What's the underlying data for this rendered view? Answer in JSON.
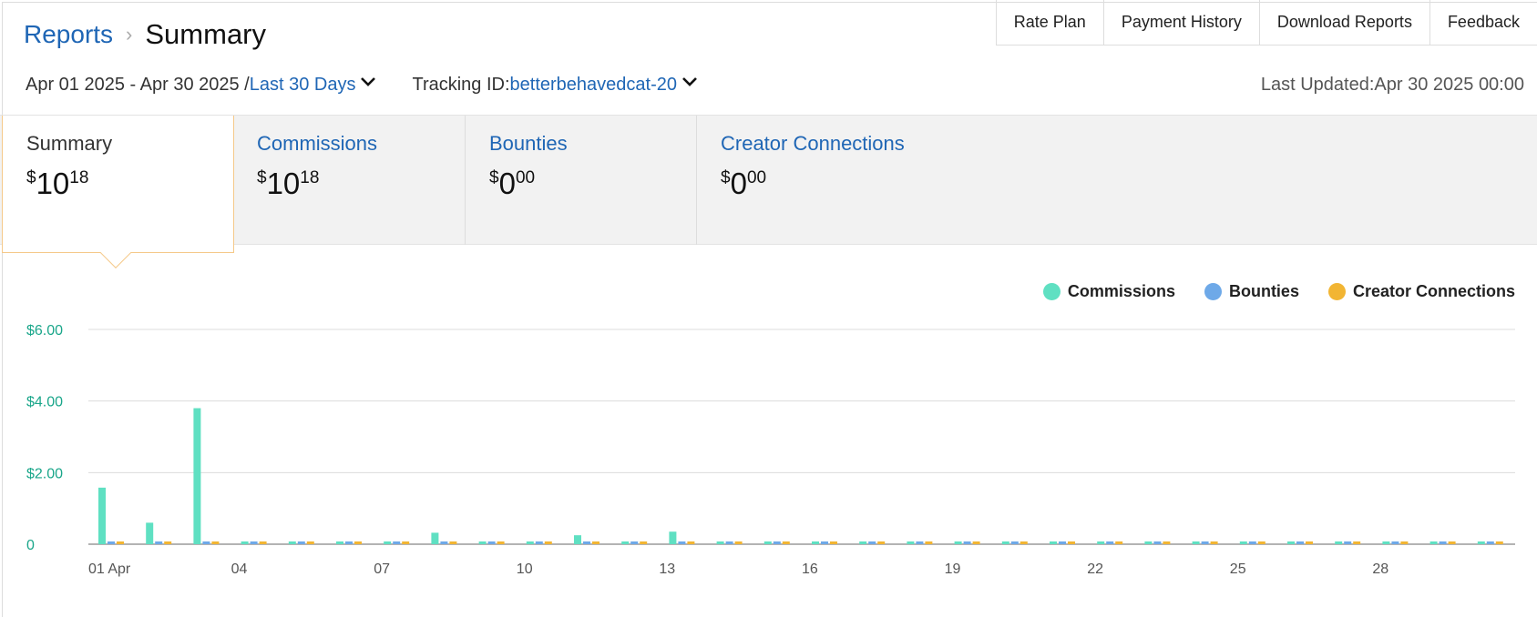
{
  "breadcrumb": {
    "parent": "Reports",
    "separator": "›",
    "current": "Summary"
  },
  "topnav": [
    "Rate Plan",
    "Payment History",
    "Download Reports",
    "Feedback"
  ],
  "filters": {
    "date_range": "Apr 01 2025 - Apr 30 2025 /",
    "range_preset": "Last 30 Days",
    "tracking_label": "Tracking ID:",
    "tracking_id": "betterbehavedcat-20",
    "last_updated": "Last Updated:Apr 30 2025 00:00"
  },
  "tiles": [
    {
      "label": "Summary",
      "currency": "$",
      "whole": "10",
      "cents": "18",
      "active": true
    },
    {
      "label": "Commissions",
      "currency": "$",
      "whole": "10",
      "cents": "18",
      "active": false
    },
    {
      "label": "Bounties",
      "currency": "$",
      "whole": "0",
      "cents": "00",
      "active": false
    },
    {
      "label": "Creator Connections",
      "currency": "$",
      "whole": "0",
      "cents": "00",
      "active": false
    }
  ],
  "legend": [
    {
      "name": "Commissions",
      "color": "#5fe0c2"
    },
    {
      "name": "Bounties",
      "color": "#6ea9e8"
    },
    {
      "name": "Creator Connections",
      "color": "#f2b533"
    }
  ],
  "chart_data": {
    "type": "bar",
    "x": [
      "01 Apr",
      "02",
      "03",
      "04",
      "05",
      "06",
      "07",
      "08",
      "09",
      "10",
      "11",
      "12",
      "13",
      "14",
      "15",
      "16",
      "17",
      "18",
      "19",
      "20",
      "21",
      "22",
      "23",
      "24",
      "25",
      "26",
      "27",
      "28",
      "29",
      "30"
    ],
    "tick_labels": [
      "01 Apr",
      "04",
      "07",
      "10",
      "13",
      "16",
      "19",
      "22",
      "25",
      "28"
    ],
    "tick_indices": [
      0,
      3,
      6,
      9,
      12,
      15,
      18,
      21,
      24,
      27
    ],
    "y_tick_labels": [
      "0",
      "$2.00",
      "$4.00",
      "$6.00"
    ],
    "y_tick_values": [
      0,
      2,
      4,
      6
    ],
    "ylim": [
      0,
      6
    ],
    "series": [
      {
        "name": "Commissions",
        "color": "#5fe0c2",
        "values": [
          1.58,
          0.6,
          3.8,
          0,
          0,
          0,
          0,
          0.32,
          0,
          0,
          0.25,
          0,
          0.35,
          0,
          0,
          0,
          0,
          0,
          0,
          0,
          0,
          0,
          0,
          0,
          0,
          0,
          0,
          0,
          0,
          0
        ]
      },
      {
        "name": "Bounties",
        "color": "#6ea9e8",
        "values": [
          0,
          0,
          0,
          0,
          0,
          0,
          0,
          0,
          0,
          0,
          0,
          0,
          0,
          0,
          0,
          0,
          0,
          0,
          0,
          0,
          0,
          0,
          0,
          0,
          0,
          0,
          0,
          0,
          0,
          0
        ]
      },
      {
        "name": "Creator Connections",
        "color": "#f2b533",
        "values": [
          0,
          0,
          0,
          0,
          0,
          0,
          0,
          0,
          0,
          0,
          0,
          0,
          0,
          0,
          0,
          0,
          0,
          0,
          0,
          0,
          0,
          0,
          0,
          0,
          0,
          0,
          0,
          0,
          0,
          0
        ]
      }
    ]
  }
}
